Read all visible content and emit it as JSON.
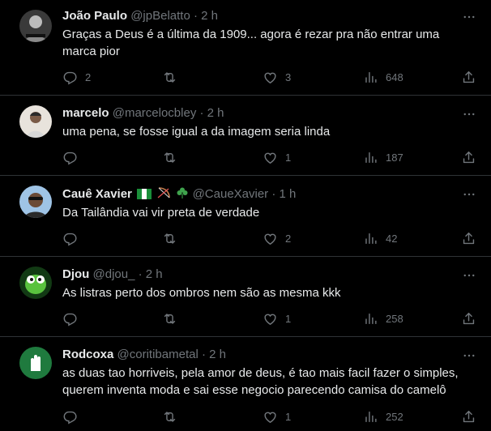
{
  "colors": {
    "background": "#000000",
    "text": "#e7e9ea",
    "muted": "#71767b",
    "divider": "#2f3336"
  },
  "icons": {
    "reply": "reply-icon",
    "retweet": "retweet-icon",
    "like": "heart-icon",
    "views": "views-icon",
    "share": "share-icon",
    "more": "more-icon"
  },
  "tweets": [
    {
      "name": "João Paulo",
      "handle": "@jpBelatto",
      "sep": "·",
      "time": "2 h",
      "text": "Graças a Deus é a última da 1909... agora é rezar pra não entrar uma marca pior",
      "replies": "2",
      "retweets": "",
      "likes": "3",
      "views": "648"
    },
    {
      "name": "marcelo",
      "handle": "@marcelocbley",
      "sep": "·",
      "time": "2 h",
      "text": "uma pena, se fosse igual a da imagem seria linda",
      "replies": "",
      "retweets": "",
      "likes": "1",
      "views": "187"
    },
    {
      "name": "Cauê Xavier",
      "handle": "@CaueXavier",
      "sep": "·",
      "time": "1 h",
      "text": "Da Tailândia vai vir preta de verdade",
      "replies": "",
      "retweets": "",
      "likes": "2",
      "views": "42"
    },
    {
      "name": "Djou",
      "handle": "@djou_",
      "sep": "·",
      "time": "2 h",
      "text": "As listras perto dos ombros nem são as mesma kkk",
      "replies": "",
      "retweets": "",
      "likes": "1",
      "views": "258"
    },
    {
      "name": "Rodcoxa",
      "handle": "@coritibametal",
      "sep": "·",
      "time": "2 h",
      "text": "as duas tao horriveis, pela amor de deus, é tao mais facil fazer o simples, querem inventa moda e sai esse negocio parecendo camisa do camelô",
      "replies": "",
      "retweets": "",
      "likes": "1",
      "views": "252"
    }
  ]
}
